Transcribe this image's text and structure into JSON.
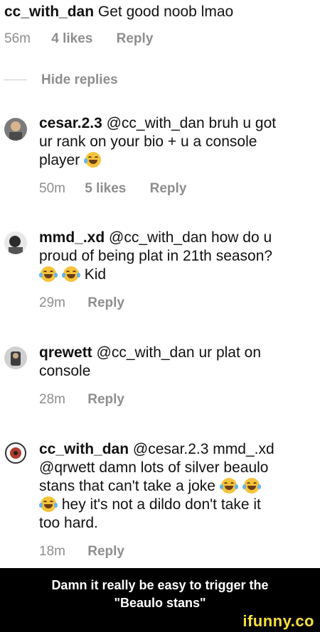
{
  "top_comment": {
    "username": "cc_with_dan",
    "text": "Get good noob lmao",
    "time": "56m",
    "likes": "4 likes",
    "reply_label": "Reply"
  },
  "hide_replies_label": "Hide replies",
  "replies": [
    {
      "username": "cesar.2.3",
      "mention": "@cc_with_dan",
      "text_line1_after": "bruh u got",
      "text_line2": "ur rank on your bio + u a console",
      "text_line3": "player",
      "time": "50m",
      "likes": "5 likes",
      "reply_label": "Reply"
    },
    {
      "username": "mmd_.xd",
      "mention": "@cc_with_dan",
      "text_line1_after": "how do u",
      "text_line2": "proud of being plat in 21th season?",
      "text_line3": "Kid",
      "time": "29m",
      "reply_label": "Reply"
    },
    {
      "username": "qrewett",
      "mention": "@cc_with_dan",
      "text_line1_after": "ur plat on",
      "text_line2": "console",
      "time": "28m",
      "reply_label": "Reply"
    },
    {
      "username": "cc_with_dan",
      "mention": "@cesar.2.3",
      "text_line1_after": "mmd_.xd",
      "text_line2": "@qrwett damn lots of silver beaulo",
      "text_line3": "stans that can't take a joke",
      "text_line4": "hey it's not a dildo don't take it",
      "text_line5": "too hard.",
      "time": "18m",
      "reply_label": "Reply"
    }
  ],
  "caption": {
    "line1": "Damn it really be easy to trigger the",
    "line2": "\"Beaulo stans\""
  },
  "watermark": "ifunny.co",
  "colors": {
    "meta_gray": "#8e8e8e",
    "watermark_yellow": "#f5e03a"
  }
}
